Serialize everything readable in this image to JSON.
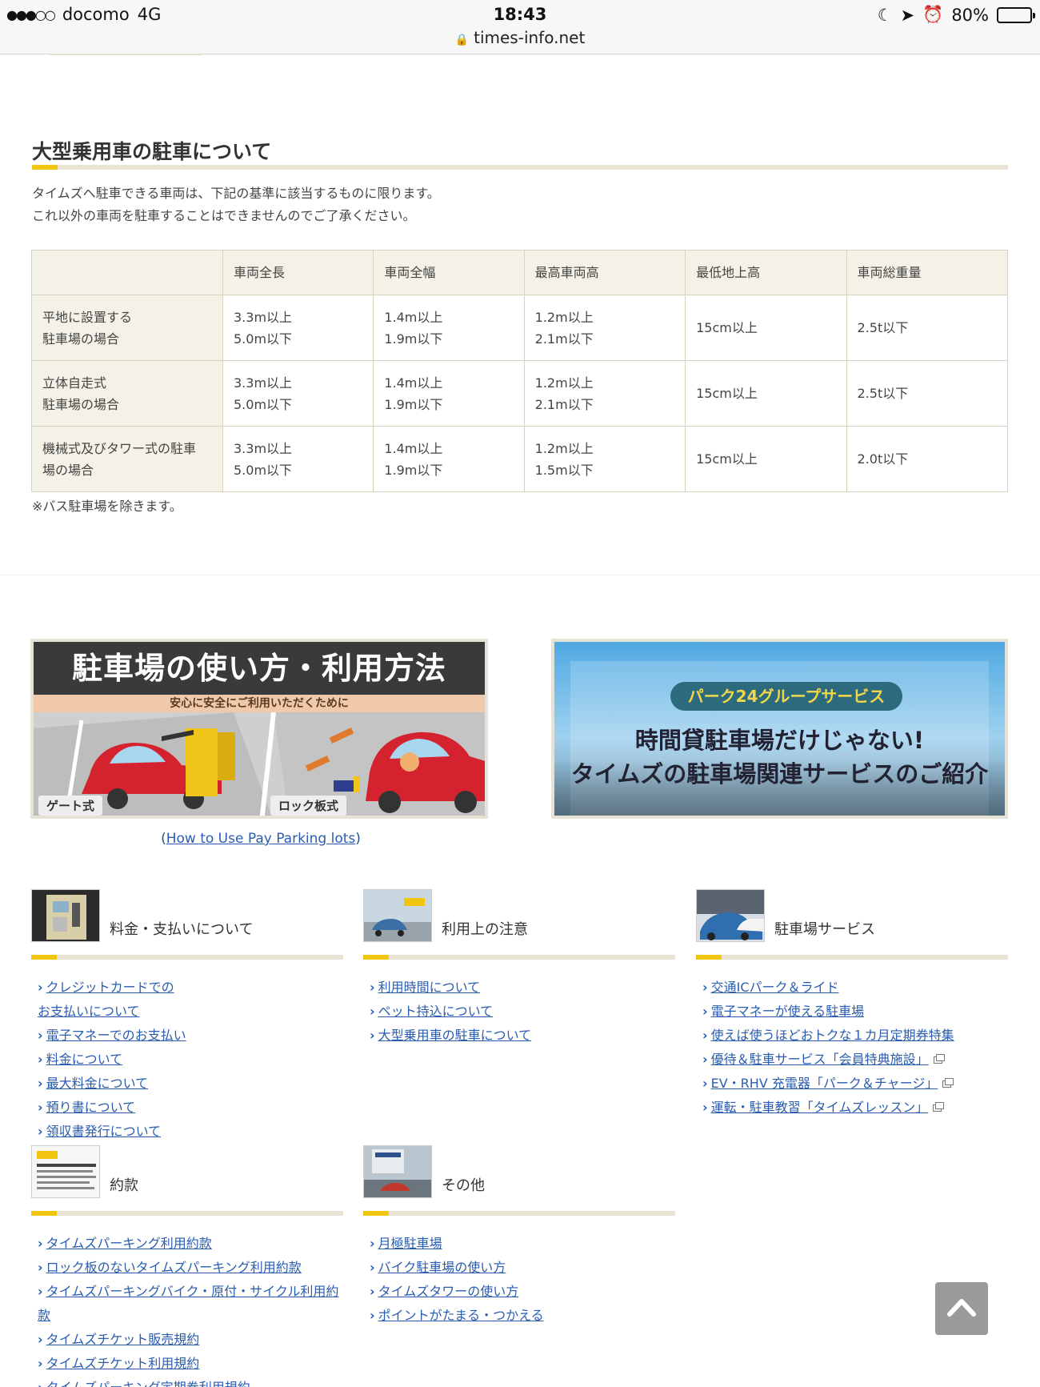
{
  "status_bar": {
    "carrier": "docomo",
    "network": "4G",
    "time": "18:43",
    "url": "times-info.net",
    "battery": "80%",
    "battery_level": 0.8
  },
  "section": {
    "title": "大型乗用車の駐車について",
    "desc_line1": "タイムズへ駐車できる車両は、下記の基準に該当するものに限ります。",
    "desc_line2": "これ以外の車両を駐車することはできませんのでご了承ください。"
  },
  "table": {
    "headers": [
      "",
      "車両全長",
      "車両全幅",
      "最高車両高",
      "最低地上高",
      "車両総重量"
    ],
    "rows": [
      {
        "head": [
          "平地に設置する",
          "駐車場の場合"
        ],
        "length": [
          "3.3m以上",
          "5.0m以下"
        ],
        "width": [
          "1.4m以上",
          "1.9m以下"
        ],
        "height": [
          "1.2m以上",
          "2.1m以下"
        ],
        "clearance": "15cm以上",
        "weight": "2.5t以下"
      },
      {
        "head": [
          "立体自走式",
          "駐車場の場合"
        ],
        "length": [
          "3.3m以上",
          "5.0m以下"
        ],
        "width": [
          "1.4m以上",
          "1.9m以下"
        ],
        "height": [
          "1.2m以上",
          "2.1m以下"
        ],
        "clearance": "15cm以上",
        "weight": "2.5t以下"
      },
      {
        "head": [
          "機械式及びタワー式の駐車",
          "場の場合"
        ],
        "length": [
          "3.3m以上",
          "5.0m以下"
        ],
        "width": [
          "1.4m以上",
          "1.9m以下"
        ],
        "height": [
          "1.2m以上",
          "1.5m以下"
        ],
        "clearance": "15cm以上",
        "weight": "2.0t以下"
      }
    ],
    "note": "※バス駐車場を除きます。"
  },
  "banner1": {
    "title": "駐車場の使い方・利用方法",
    "subtitle": "安心に安全にご利用いただくために",
    "label_gate": "ゲート式",
    "label_lock": "ロック板式",
    "caption_open": "(",
    "caption_link": "How to Use Pay Parking lots",
    "caption_close": ")"
  },
  "banner2": {
    "pill": "パーク24グループサービス",
    "line1": "時間貸駐車場だけじゃない!",
    "line2": "タイムズの駐車場関連サービスのご紹介"
  },
  "categories": {
    "payment": {
      "title": "料金・支払いについて",
      "links": [
        "クレジットカードでの",
        "お支払いについて",
        "電子マネーでのお支払い",
        "料金について",
        "最大料金について",
        "預り書について",
        "領収書発行について"
      ]
    },
    "notes": {
      "title": "利用上の注意",
      "links": [
        "利用時間について",
        "ペット持込について",
        "大型乗用車の駐車について"
      ]
    },
    "services": {
      "title": "駐車場サービス",
      "links": [
        "交通ICパーク＆ライド",
        "電子マネーが使える駐車場",
        "使えば使うほどおトクな１カ月定期券特集",
        "優待＆駐車サービス「会員特典施設」",
        "EV・RHV 充電器「パーク＆チャージ」",
        "運転・駐車教習「タイムズレッスン」"
      ]
    },
    "terms": {
      "title": "約款",
      "links": [
        "タイムズパーキング利用約款",
        "ロック板のないタイムズパーキング利用約款",
        "タイムズパーキングバイク・原付・サイクル利用約",
        "款",
        "タイムズチケット販売規約",
        "タイムズチケット利用規約",
        "タイムズパーキング定期券利用規約"
      ]
    },
    "other": {
      "title": "その他",
      "links": [
        "月極駐車場",
        "バイク駐車場の使い方",
        "タイムズタワーの使い方",
        "ポイントがたまる・つかえる"
      ]
    }
  },
  "colors": {
    "accent": "#f1c40f",
    "rule": "#e8e3d3",
    "link": "#2a5db0",
    "table_head": "#f4f1e6"
  }
}
